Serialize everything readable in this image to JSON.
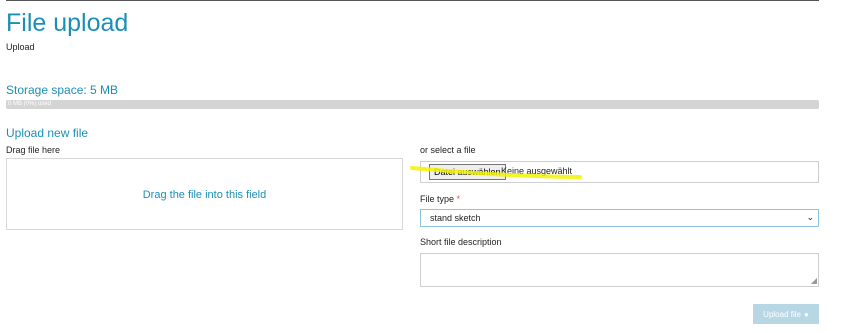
{
  "header": {
    "title": "File upload",
    "breadcrumb": "Upload"
  },
  "storage": {
    "title": "Storage space: 5 MB",
    "bar_text": "0 MB (0%) used",
    "used_fraction": 0.0
  },
  "upload": {
    "heading": "Upload new file",
    "drag_label": "Drag file here",
    "drop_zone_text": "Drag the file into this field",
    "select_label": "or select a file",
    "choose_button": "Datei auswählen",
    "no_file_text": "Keine ausgewählt",
    "file_type_label": "File type",
    "required_mark": "*",
    "file_type_value": "stand sketch",
    "description_label": "Short file description",
    "description_value": "",
    "submit_label": "Upload file"
  },
  "colors": {
    "accent": "#1c8fb5",
    "highlight": "#f2f200",
    "disabled_button": "#b8d7e4"
  }
}
